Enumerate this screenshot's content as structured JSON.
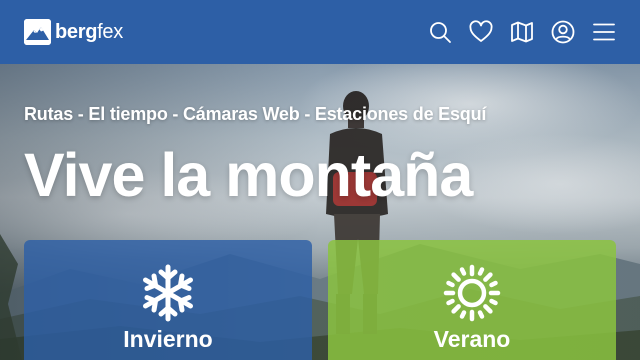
{
  "brand": {
    "name_bold": "berg",
    "name_light": "fex"
  },
  "nav": {
    "icons": [
      "search-icon",
      "heart-icon",
      "map-icon",
      "user-icon",
      "menu-icon"
    ]
  },
  "hero": {
    "subtitle": "Rutas - El tiempo - Cámaras Web - Estaciones de Esquí",
    "title": "Vive la montaña"
  },
  "cards": {
    "winter": {
      "label": "Invierno",
      "icon": "snowflake-icon",
      "color": "#2d5fa6"
    },
    "summer": {
      "label": "Verano",
      "icon": "sun-icon",
      "color": "#8bc33f"
    }
  },
  "colors": {
    "header": "#2d5fa6",
    "text": "#ffffff"
  }
}
